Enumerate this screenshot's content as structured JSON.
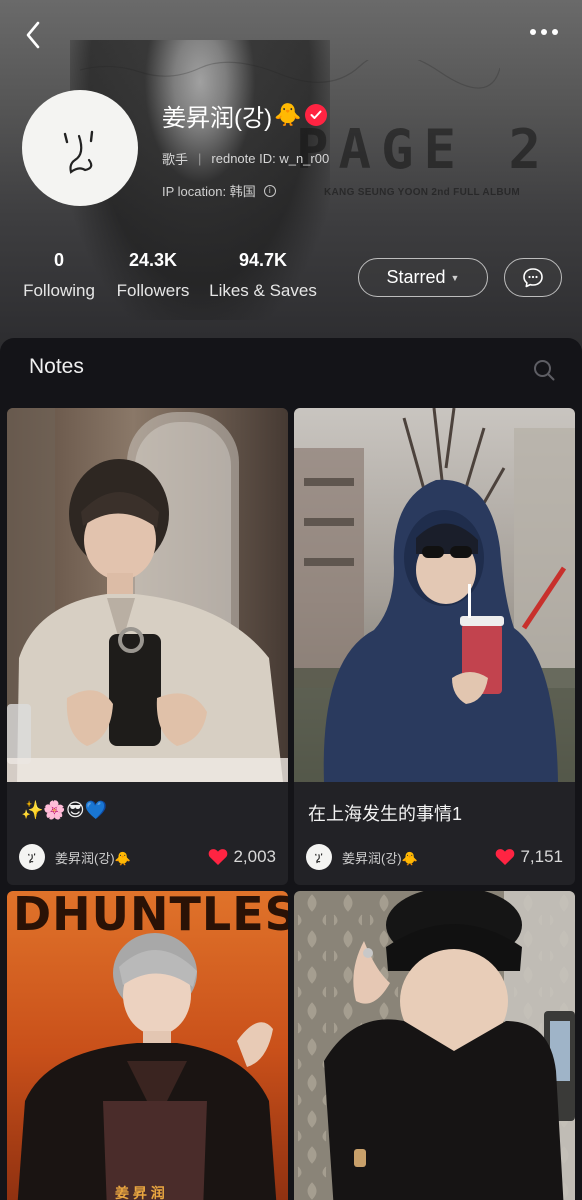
{
  "header": {
    "back_icon": "chevron-left-icon",
    "more_icon": "more-dots-icon",
    "album": {
      "title": "PAGE 2",
      "subtitle": "KANG SEUNG YOON 2nd FULL ALBUM"
    }
  },
  "profile": {
    "name": "姜昇润(강)",
    "name_emoji": "🐥",
    "verified": true,
    "occupation": "歌手",
    "rednote_id": "rednote ID: w_n_r00",
    "ip_location": "IP location: 韩国",
    "stats": [
      {
        "value": "0",
        "label": "Following"
      },
      {
        "value": "24.3K",
        "label": "Followers"
      },
      {
        "value": "94.7K",
        "label": "Likes & Saves"
      }
    ],
    "starred_label": "Starred",
    "message_icon": "chat-bubble-icon"
  },
  "notes": {
    "title": "Notes",
    "search_icon": "search-icon",
    "cards": [
      {
        "caption": "✨🌸😎💙",
        "author": "姜昇润(강)🐥",
        "likes": "2,003"
      },
      {
        "caption": "在上海发生的事情1",
        "author": "姜昇润(강)🐥",
        "likes": "7,151"
      },
      {
        "poster_text": "DHUNTLESS",
        "poster_name": "姜 昇 润"
      },
      {}
    ]
  },
  "colors": {
    "accent": "#ff2442",
    "background": "#141418",
    "card": "#222226"
  }
}
